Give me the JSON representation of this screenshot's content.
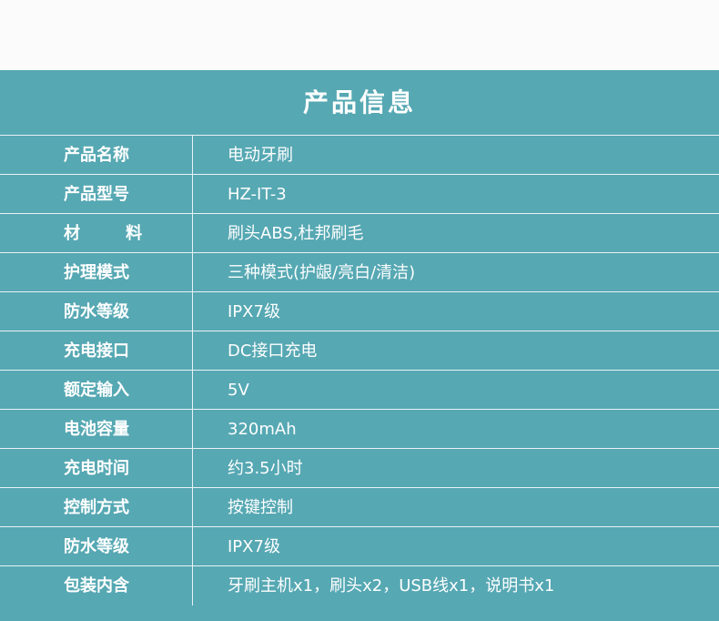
{
  "title": "产品信息",
  "rows": [
    {
      "label": "产品名称",
      "value": "电动牙刷"
    },
    {
      "label": "产品型号",
      "value": "HZ-IT-3"
    },
    {
      "label": "材        料",
      "value": "刷头ABS,杜邦刷毛"
    },
    {
      "label": "护理模式",
      "value": "三种模式(护龈/亮白/清洁)"
    },
    {
      "label": "防水等级",
      "value": "IPX7级"
    },
    {
      "label": "充电接口",
      "value": "DC接口充电"
    },
    {
      "label": "额定输入",
      "value": "5V"
    },
    {
      "label": "电池容量",
      "value": "320mAh"
    },
    {
      "label": "充电时间",
      "value": "约3.5小时"
    },
    {
      "label": "控制方式",
      "value": "按键控制"
    },
    {
      "label": "防水等级",
      "value": "IPX7级"
    },
    {
      "label": "包装内含",
      "value": "牙刷主机x1，刷头x2，USB线x1，说明书x1"
    }
  ]
}
